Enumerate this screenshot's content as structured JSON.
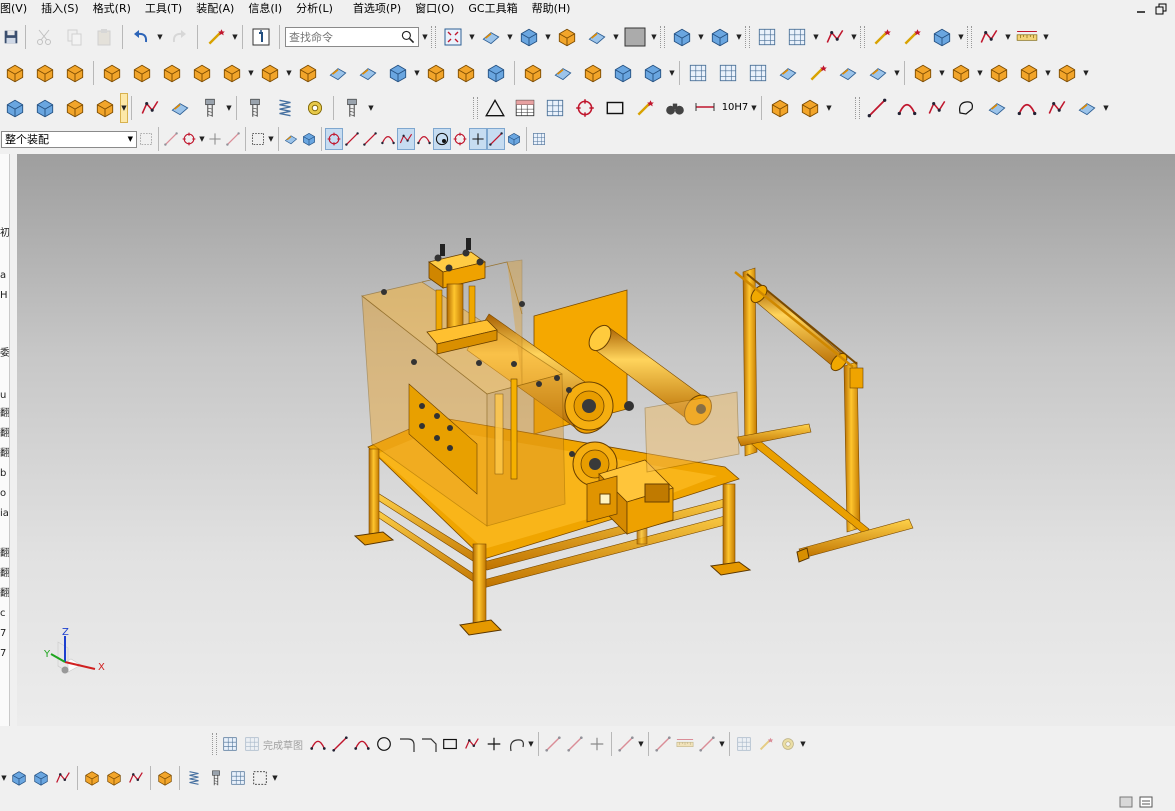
{
  "menu": {
    "items": [
      "图(V)",
      "插入(S)",
      "格式(R)",
      "工具(T)",
      "装配(A)",
      "信息(I)",
      "分析(L)",
      "首选项(P)",
      "窗口(O)",
      "GC工具箱",
      "帮助(H)"
    ]
  },
  "toolbar": {
    "search_placeholder": "查找命令",
    "assembly_filter": "整个装配",
    "tolerance_label": "10H7"
  },
  "sketch_toolbar": {
    "finish_sketch_label": "完成草图"
  },
  "left_panel": {
    "fragments": [
      "初",
      "a",
      "H",
      "委",
      "u",
      "翻",
      "翻",
      "翻",
      "b",
      "o",
      "ia",
      "翻",
      "翻",
      "翻",
      "c",
      "7",
      "7"
    ]
  },
  "colors": {
    "model": "#f5a800",
    "viewport_top": "#9e9e9e",
    "viewport_bottom": "#ececec",
    "background": "#f0f0f0"
  },
  "triad": {
    "x": "X",
    "y": "Y",
    "z": "Z"
  }
}
